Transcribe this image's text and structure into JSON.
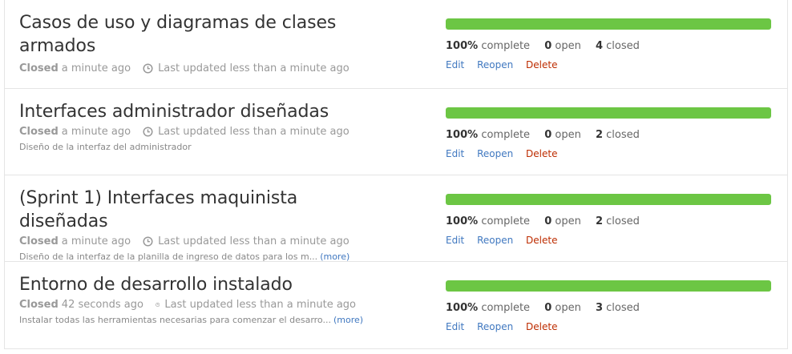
{
  "milestones": [
    {
      "title": "Casos de uso y diagramas de clases armados",
      "status": "Closed",
      "closed_ago": "a minute ago",
      "updated": "Last updated less than a minute ago",
      "description": "",
      "more": "",
      "percent": "100%",
      "percent_value": 100,
      "complete_label": "complete",
      "open_count": "0",
      "open_label": "open",
      "closed_count": "4",
      "closed_label": "closed",
      "edit": "Edit",
      "reopen": "Reopen",
      "delete": "Delete"
    },
    {
      "title": "Interfaces administrador diseñadas",
      "status": "Closed",
      "closed_ago": "a minute ago",
      "updated": "Last updated less than a minute ago",
      "description": "Diseño de la interfaz del administrador",
      "more": "",
      "percent": "100%",
      "percent_value": 100,
      "complete_label": "complete",
      "open_count": "0",
      "open_label": "open",
      "closed_count": "2",
      "closed_label": "closed",
      "edit": "Edit",
      "reopen": "Reopen",
      "delete": "Delete"
    },
    {
      "title": "(Sprint 1) Interfaces maquinista diseñadas",
      "status": "Closed",
      "closed_ago": "a minute ago",
      "updated": "Last updated less than a minute ago",
      "description": "Diseño de la interfaz de la planilla de ingreso de datos para los m...",
      "more": "(more)",
      "percent": "100%",
      "percent_value": 100,
      "complete_label": "complete",
      "open_count": "0",
      "open_label": "open",
      "closed_count": "2",
      "closed_label": "closed",
      "edit": "Edit",
      "reopen": "Reopen",
      "delete": "Delete"
    },
    {
      "title": "Entorno de desarrollo instalado",
      "status": "Closed",
      "closed_ago": "42 seconds ago",
      "updated": "Last updated less than a minute ago",
      "description": "Instalar todas las herramientas necesarias para comenzar el desarro...",
      "more": "(more)",
      "percent": "100%",
      "percent_value": 100,
      "complete_label": "complete",
      "open_count": "0",
      "open_label": "open",
      "closed_count": "3",
      "closed_label": "closed",
      "edit": "Edit",
      "reopen": "Reopen",
      "delete": "Delete"
    }
  ],
  "colors": {
    "progress": "#6cc644",
    "link": "#4078c0",
    "delete": "#bd2c00"
  },
  "icons": {
    "updated": "clock-icon"
  }
}
